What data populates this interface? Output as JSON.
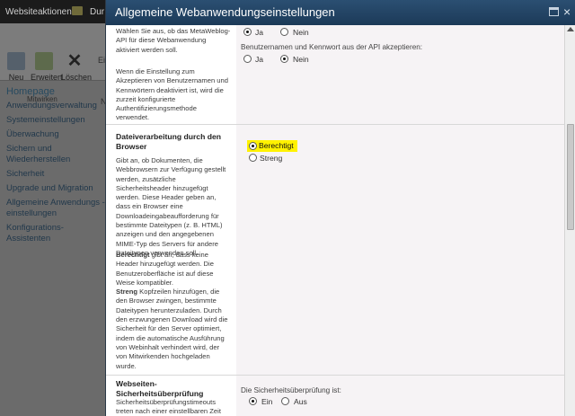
{
  "background": {
    "site_actions": "Websiteaktionen",
    "browse_partial": "Dur",
    "ribbon": {
      "new_label": "Neu",
      "extend_label": "Erweitert",
      "delete_label": "Löschen",
      "group_label": "Mitwirken",
      "edit_partial": "Ei",
      "new_partial": "N"
    },
    "nav": {
      "home": "Homepage",
      "items": [
        "Anwendungsverwaltung",
        "Systemeinstellungen",
        "Überwachung",
        "Sichern und Wiederherstellen",
        "Sicherheit",
        "Upgrade und Migration",
        "Allgemeine Anwendungs - einstellungen",
        "Konfigurations-Assistenten"
      ]
    }
  },
  "dialog": {
    "title": "Allgemeine Webanwendungseinstellungen",
    "close_glyph": "×",
    "metaweblog": {
      "description_1": "Wählen Sie aus, ob das MetaWeblog-API für diese Webanwendung aktiviert werden soll.",
      "description_2": "Wenn die Einstellung zum Akzeptieren von Benutzernamen und Kennwörtern deaktiviert ist, wird die zurzeit konfigurierte Authentifizierungsmethode verwendet.",
      "option_yes": "Ja",
      "option_no": "Nein",
      "selected": "Ja",
      "api_label": "Benutzernamen und Kennwort aus der API akzeptieren:",
      "api_selected": "Nein"
    },
    "browser_file_handling": {
      "title": "Dateiverarbeitung durch den Browser",
      "description_1": "Gibt an, ob Dokumenten, die Webbrowsern zur Verfügung gestellt werden, zusätzliche Sicherheitsheader hinzugefügt werden. Diese Header geben an, dass ein Browser eine Downloadeingabeaufforderung für bestimmte Dateitypen (z. B. HTML) anzeigen und den angegebenen MIME-Typ des Servers für andere Dateitypen verwenden soll.",
      "description_2_bold": "Berechtigt",
      "description_2": " gibt an, dass keine Header hinzugefügt werden. Die Benutzeroberfläche ist auf diese Weise kompatibler.",
      "description_3_bold": "Streng",
      "description_3": " Kopfzeilen hinzufügen, die den Browser zwingen, bestimmte Dateitypen herunterzuladen. Durch den erzwungenen Download wird die Sicherheit für den Server optimiert, indem die automatische Ausführung von Webinhalt verhindert wird, der von Mitwirkenden hochgeladen wurde.",
      "option_permissive": "Berechtigt",
      "option_strict": "Streng",
      "selected": "Berechtigt"
    },
    "security_validation": {
      "title": "Webseiten-Sicherheitsüberprüfung",
      "description": "Sicherheitsüberprüfungstimeouts treten nach einer einstellbaren Zeit",
      "label": "Die Sicherheitsüberprüfung ist:",
      "option_on": "Ein",
      "option_off": "Aus",
      "selected": "Ein"
    }
  }
}
